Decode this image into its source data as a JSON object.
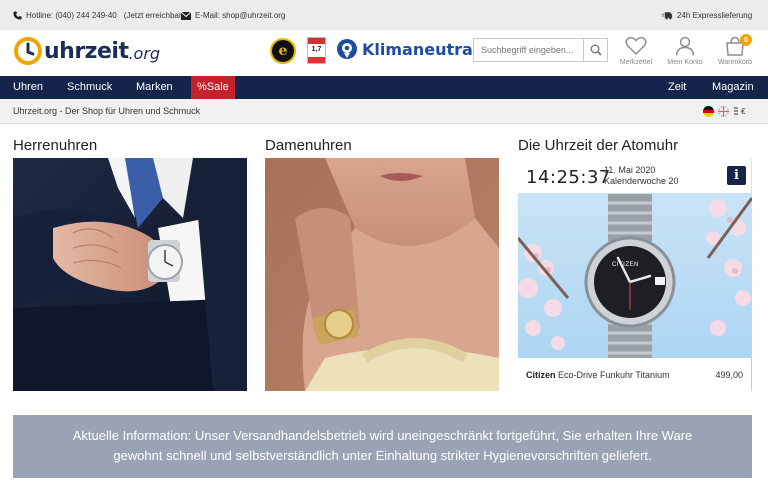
{
  "topbar": {
    "hotline": "Hotline: (040) 244 249-40",
    "hotline_note": "(Jetzt erreichbar)",
    "email": "E-Mail: shop@uhrzeit.org",
    "shipping": "24h Expresslieferung"
  },
  "header": {
    "logo_text": "uhrzeit",
    "logo_tld": ".org",
    "trusted_badge": "e",
    "rating_value": "1,7",
    "klima_label": "Klimaneutral",
    "search_placeholder": "Suchbegriff eingeben...",
    "wishlist_label": "Merkzettel",
    "account_label": "Mein Konto",
    "cart_label": "Warenkorb",
    "cart_count": "0"
  },
  "nav": {
    "items": [
      "Uhren",
      "Schmuck",
      "Marken",
      "%Sale"
    ],
    "right_items": [
      "Zeit",
      "Magazin"
    ]
  },
  "breadcrumb": {
    "text": "Uhrzeit.org - Der Shop für Uhren und Schmuck",
    "currency": "€"
  },
  "columns": {
    "men_title": "Herrenuhren",
    "women_title": "Damenuhren",
    "atom_title": "Die Uhrzeit der Atomuhr"
  },
  "atom_clock": {
    "time": "14:25:37",
    "date": "11. Mai 2020",
    "week": "Kalenderwoche 20",
    "info": "i",
    "watch_brand_dial": "CITIZEN",
    "product_brand": "Citizen",
    "product_name": "Eco-Drive Funkuhr Titanium",
    "product_price": "499,00"
  },
  "notice": {
    "line1": "Aktuelle Information: Unser Versandhandelsbetrieb wird uneingeschränkt fortgeführt, Sie erhalten Ihre Ware",
    "line2": "gewohnt schnell und selbstverständlich unter Einhaltung strikter Hygienevorschriften geliefert."
  },
  "colors": {
    "nav_bg": "#14244a",
    "sale_bg": "#c3232c",
    "logo_orange": "#f0a500",
    "notice_bg": "#9aa3b6"
  }
}
